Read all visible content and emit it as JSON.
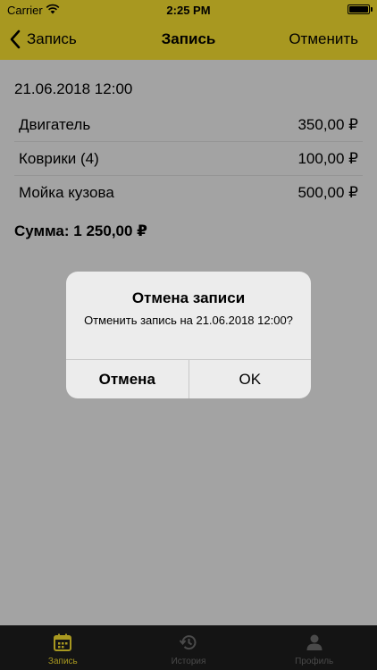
{
  "status_bar": {
    "carrier": "Carrier",
    "time": "2:25 PM"
  },
  "nav": {
    "back_label": "Запись",
    "title": "Запись",
    "cancel_label": "Отменить"
  },
  "booking": {
    "datetime": "21.06.2018 12:00",
    "items": [
      {
        "name": "Двигатель",
        "price": "350,00 ₽"
      },
      {
        "name": "Коврики (4)",
        "price": "100,00 ₽"
      },
      {
        "name": "Мойка кузова",
        "price": "500,00 ₽"
      }
    ],
    "total": "Сумма: 1 250,00 ₽"
  },
  "alert": {
    "title": "Отмена записи",
    "message": "Отменить запись на 21.06.2018 12:00?",
    "cancel_button": "Отмена",
    "ok_button": "OK"
  },
  "tabbar": {
    "tabs": [
      {
        "label": "Запись",
        "icon": "calendar-icon",
        "active": true
      },
      {
        "label": "История",
        "icon": "history-icon",
        "active": false
      },
      {
        "label": "Профиль",
        "icon": "profile-icon",
        "active": false
      }
    ]
  },
  "colors": {
    "accent": "#a89820",
    "overlay_bg": "#a3a3a3",
    "alert_bg": "#ececec",
    "tabbar_bg": "#141414"
  }
}
